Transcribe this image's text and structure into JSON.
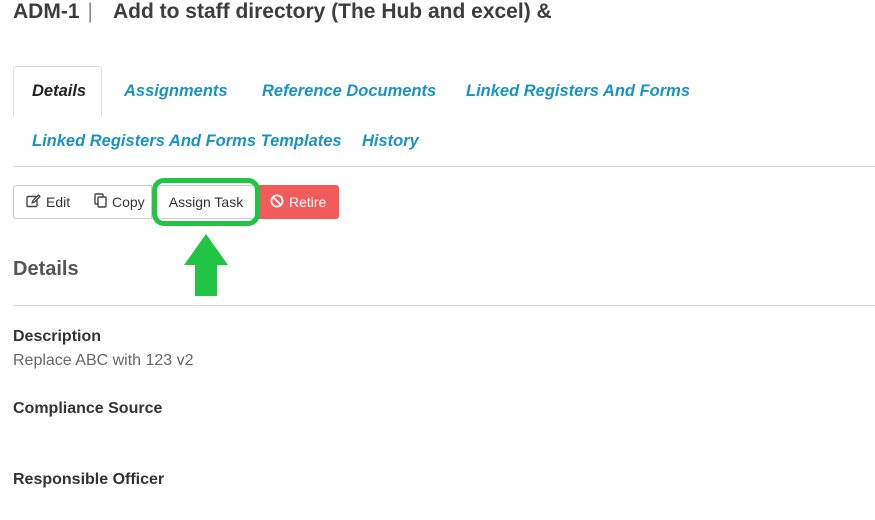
{
  "header": {
    "code": "ADM-1",
    "separator": "|",
    "title": "Add to staff directory (The Hub and excel) &"
  },
  "tabs": [
    {
      "label": "Details",
      "active": true
    },
    {
      "label": "Assignments",
      "active": false
    },
    {
      "label": "Reference Documents",
      "active": false
    },
    {
      "label": "Linked Registers And Forms",
      "active": false
    },
    {
      "label": "Linked Registers And Forms Templates",
      "active": false
    },
    {
      "label": "History",
      "active": false
    }
  ],
  "toolbar": {
    "edit_label": "Edit",
    "copy_label": "Copy",
    "assign_label": "Assign Task",
    "retire_label": "Retire"
  },
  "details": {
    "heading": "Details",
    "fields": [
      {
        "label": "Description",
        "value": "Replace ABC with 123 v2"
      },
      {
        "label": "Compliance Source",
        "value": ""
      },
      {
        "label": "Responsible Officer",
        "value": ""
      }
    ]
  },
  "icons": {
    "edit": "edit-icon",
    "copy": "copy-icon",
    "retire": "ban-icon"
  },
  "colors": {
    "tab_link": "#1a93c2",
    "retire_button": "#f15b5b",
    "highlight": "#1fc543"
  }
}
